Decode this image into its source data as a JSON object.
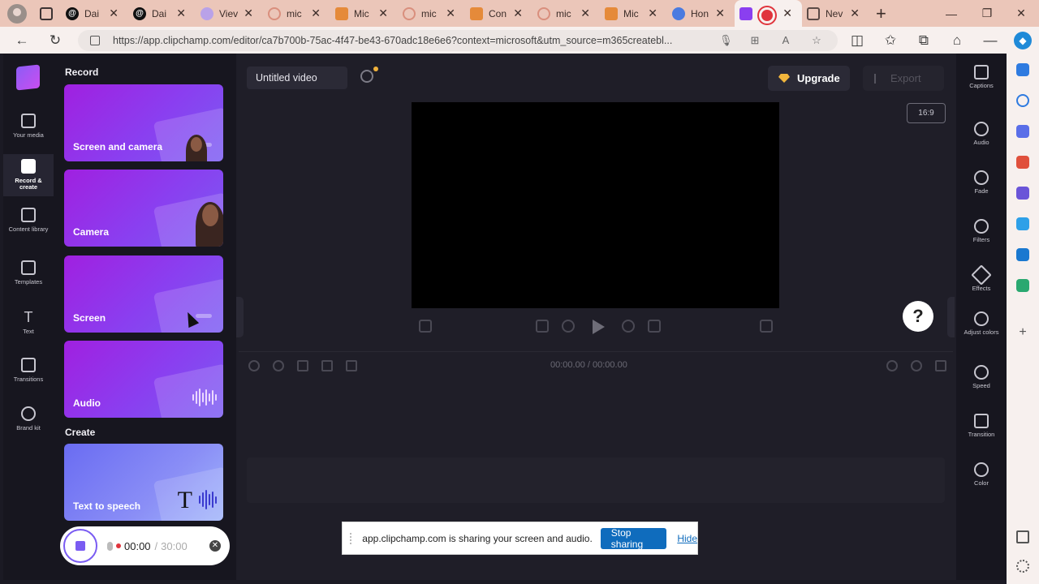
{
  "browser": {
    "tabs": [
      {
        "label": "Dai",
        "favicon": "threads-icon",
        "color": "#111111"
      },
      {
        "label": "Dai",
        "favicon": "threads-icon",
        "color": "#111111"
      },
      {
        "label": "Viev",
        "favicon": "circle-icon",
        "color": "#b9a2e8"
      },
      {
        "label": "mic",
        "favicon": "search-icon",
        "color": "#d98f7d"
      },
      {
        "label": "Mic",
        "favicon": "office-icon",
        "color": "#e58a3a"
      },
      {
        "label": "mic",
        "favicon": "search-icon",
        "color": "#d98f7d"
      },
      {
        "label": "Con",
        "favicon": "office-icon",
        "color": "#e58a3a"
      },
      {
        "label": "mic",
        "favicon": "search-icon",
        "color": "#d98f7d"
      },
      {
        "label": "Mic",
        "favicon": "office-icon",
        "color": "#e58a3a"
      },
      {
        "label": "Hon",
        "favicon": "google-icon",
        "color": "#4a7be0"
      },
      {
        "label": "",
        "favicon": "clipchamp-icon",
        "color": "#8a3ff0"
      },
      {
        "label": "Nev",
        "favicon": "newtab-icon",
        "color": "#5b4a46"
      }
    ],
    "url": "https://app.clipchamp.com/editor/ca7b700b-75ac-4f47-be43-670adc18e6e6?context=microsoft&utm_source=m365createbl..."
  },
  "leftrail": {
    "items": [
      {
        "label": "Your media",
        "icon": "folder-icon"
      },
      {
        "label": "Record & create",
        "icon": "camera-icon",
        "active": true
      },
      {
        "label": "Content library",
        "icon": "library-icon"
      },
      {
        "label": "Templates",
        "icon": "templates-icon"
      },
      {
        "label": "Text",
        "icon": "text-icon"
      },
      {
        "label": "Transitions",
        "icon": "transitions-icon"
      },
      {
        "label": "Brand kit",
        "icon": "brand-kit-icon"
      }
    ]
  },
  "panel": {
    "record_title": "Record",
    "create_title": "Create",
    "cards": [
      {
        "label": "Screen and camera"
      },
      {
        "label": "Camera"
      },
      {
        "label": "Screen"
      },
      {
        "label": "Audio"
      }
    ],
    "create_cards": [
      {
        "label": "Text to speech"
      }
    ]
  },
  "recorder": {
    "elapsed": "00:00",
    "separator": "/",
    "limit": "30:00"
  },
  "editor": {
    "title": "Untitled video",
    "upgrade_label": "Upgrade",
    "export_label": "Export",
    "aspect_ratio": "16:9",
    "timecode": "00:00.00 / 00:00.00",
    "help_label": "?"
  },
  "rightrail": {
    "items": [
      {
        "label": "Captions",
        "icon": "captions-icon"
      },
      {
        "label": "Audio",
        "icon": "speaker-icon"
      },
      {
        "label": "Fade",
        "icon": "fade-icon"
      },
      {
        "label": "Filters",
        "icon": "filters-icon"
      },
      {
        "label": "Effects",
        "icon": "effects-icon"
      },
      {
        "label": "Adjust colors",
        "icon": "adjust-colors-icon"
      },
      {
        "label": "Speed",
        "icon": "speed-icon"
      },
      {
        "label": "Transition",
        "icon": "transition-icon"
      },
      {
        "label": "Color",
        "icon": "color-icon"
      }
    ]
  },
  "share_notification": {
    "message": "app.clipchamp.com is sharing your screen and audio.",
    "stop_label": "Stop sharing",
    "hide_label": "Hide"
  }
}
